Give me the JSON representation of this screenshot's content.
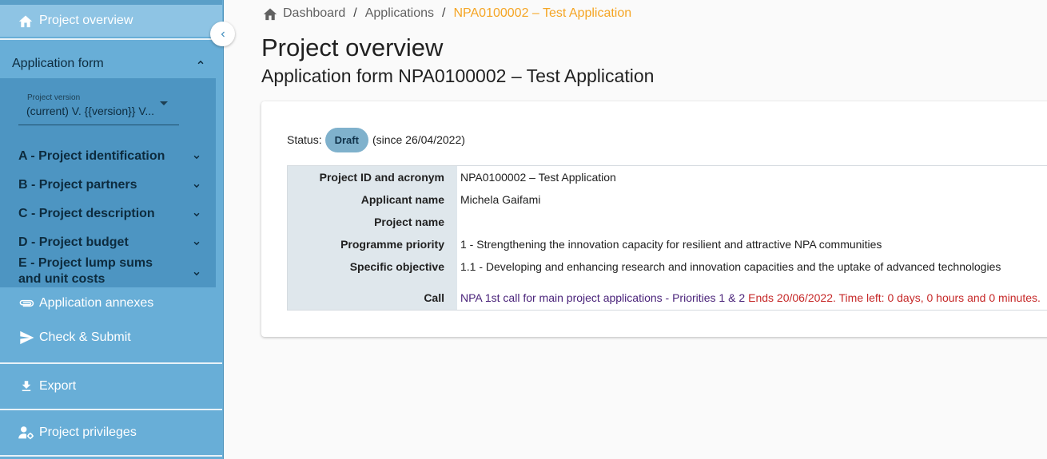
{
  "sidebar": {
    "project_overview": "Project overview",
    "application_form": "Application form",
    "version": {
      "label": "Project version",
      "value": "(current) V. {{version}} V..."
    },
    "sections": [
      "A - Project identification",
      "B - Project partners",
      "C - Project description",
      "D - Project budget",
      "E - Project lump sums and unit costs"
    ],
    "application_annexes": "Application annexes",
    "check_submit": "Check & Submit",
    "export": "Export",
    "project_privileges": "Project privileges"
  },
  "breadcrumb": {
    "dashboard": "Dashboard",
    "applications": "Applications",
    "current": "NPA0100002 – Test Application"
  },
  "page": {
    "title": "Project overview",
    "subtitle": "Application form NPA0100002 – Test Application"
  },
  "status": {
    "label": "Status:",
    "badge": "Draft",
    "since": "(since 26/04/2022)"
  },
  "info": {
    "project_id_label": "Project ID and acronym",
    "project_id_value": "NPA0100002 – Test Application",
    "applicant_label": "Applicant name",
    "applicant_value": "Michela Gaifami",
    "project_name_label": "Project name",
    "project_name_value": "",
    "priority_label": "Programme priority",
    "priority_value": "1 - Strengthening the innovation capacity for resilient and attractive NPA communities",
    "objective_label": "Specific objective",
    "objective_value": "1.1 - Developing and enhancing research and innovation capacities and the uptake of advanced technologies",
    "call_label": "Call",
    "call_link": "NPA 1st call for main project applications - Priorities 1 & 2",
    "call_ends": "Ends 20/06/2022. Time left: 0 days, 0 hours and 0 minutes."
  },
  "colors": {
    "sidebar": "#68aed7",
    "sidebar_active": "#8ec4e4",
    "sidebar_section": "#4d95c2",
    "breadcrumb_current": "#f5a524",
    "badge": "#7fb1cc",
    "call_ends": "#c62828"
  }
}
